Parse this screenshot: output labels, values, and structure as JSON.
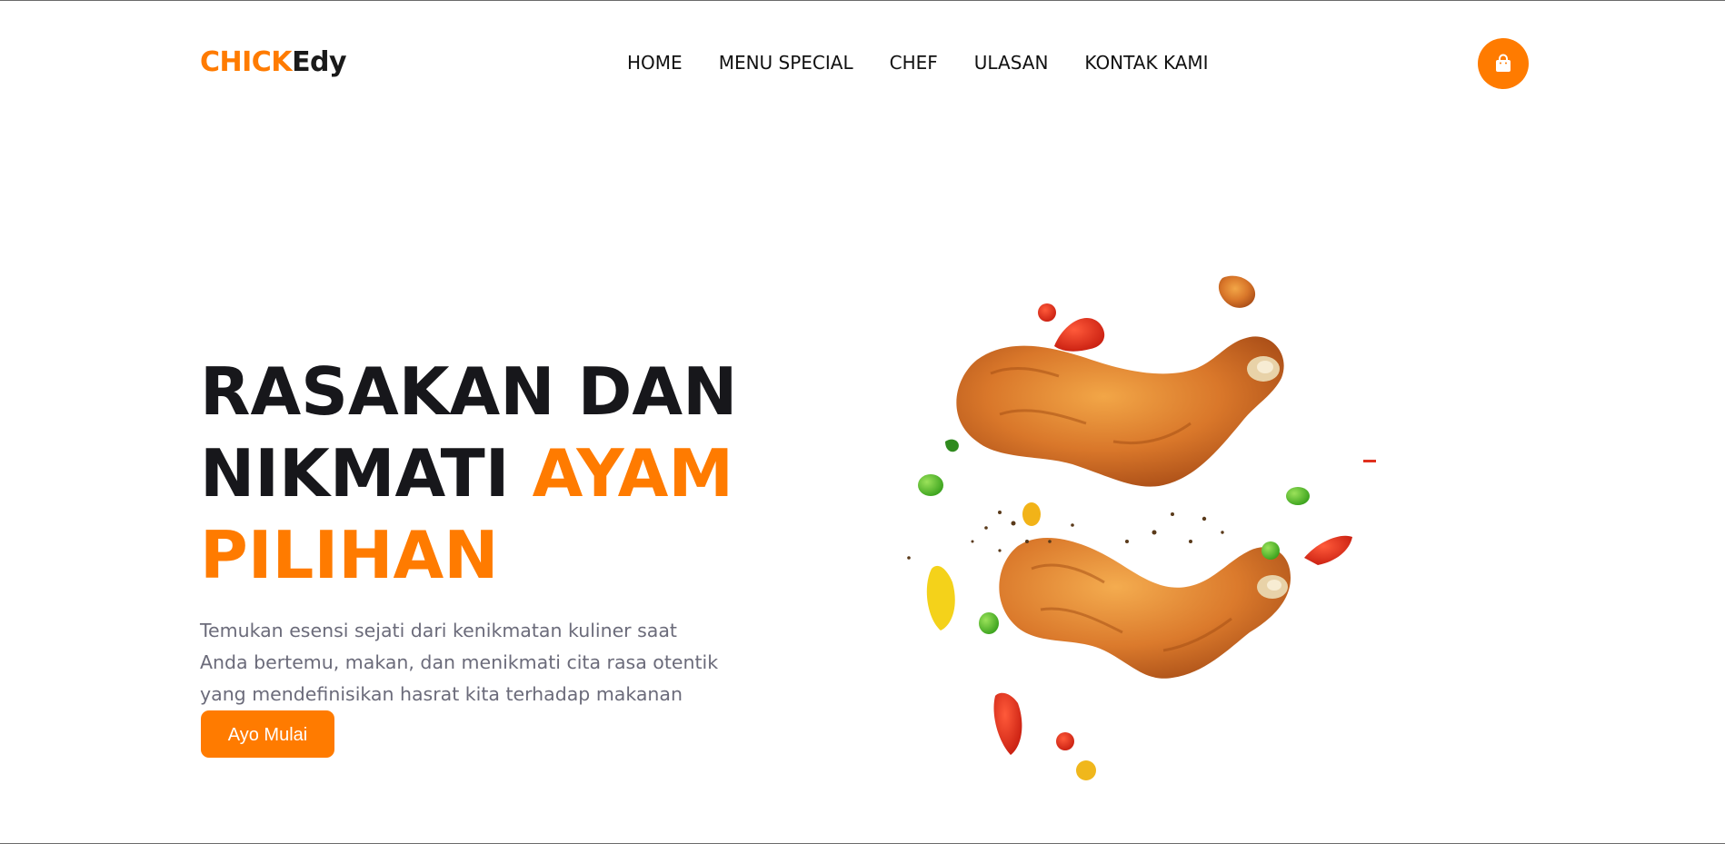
{
  "brand": {
    "part1": "CHICK",
    "part2": "Edy"
  },
  "nav": {
    "items": [
      "HOME",
      "MENU SPECIAL",
      "CHEF",
      "ULASAN",
      "KONTAK KAMI"
    ]
  },
  "cart": {
    "icon": "shopping-bag-icon"
  },
  "hero": {
    "title_line1": "RASAKAN DAN",
    "title_line2_dark": "NIKMATI ",
    "title_line2_accent": "AYAM",
    "title_line3_accent": "PILIHAN",
    "description": "Temukan esensi sejati dari kenikmatan kuliner saat Anda bertemu, makan, dan menikmati cita rasa otentik yang mendefinisikan hasrat kita terhadap makanan",
    "cta_label": "Ayo Mulai"
  },
  "illustration": {
    "subject": "fried-chicken-image"
  },
  "colors": {
    "accent": "#ff7b00",
    "heading": "#17171b",
    "body_text": "#6b6b7a"
  }
}
